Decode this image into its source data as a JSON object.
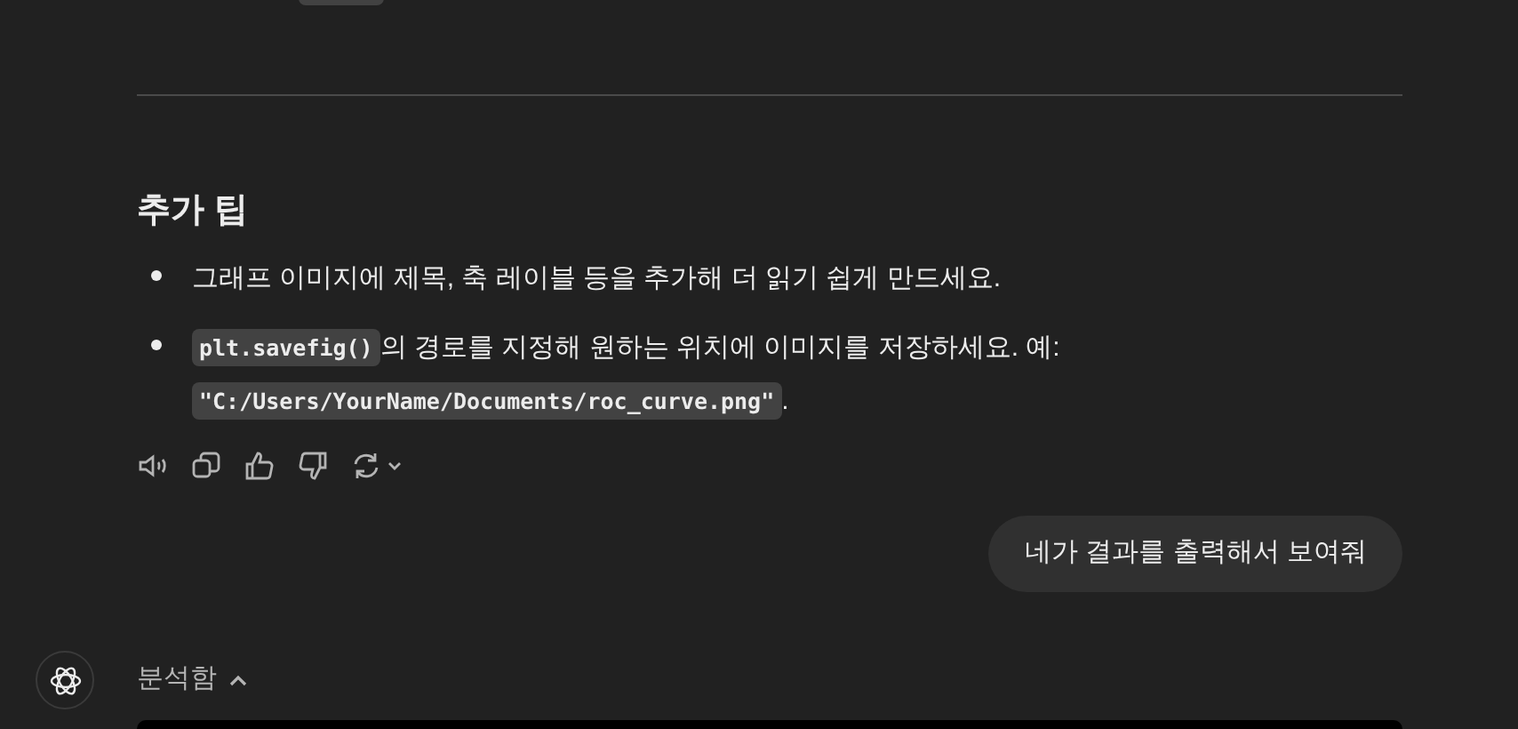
{
  "heading": "추가 팁",
  "bullets": [
    {
      "parts": [
        {
          "kind": "text",
          "text": "그래프 이미지에 제목, 축 레이블 등을 추가해 더 읽기 쉽게 만드세요."
        }
      ]
    },
    {
      "parts": [
        {
          "kind": "code",
          "text": "plt.savefig()"
        },
        {
          "kind": "text",
          "text": "의 경로를 지정해 원하는 위치에 이미지를 저장하세요. 예:"
        },
        {
          "kind": "code",
          "text": "\"C:/Users/YourName/Documents/roc_curve.png\""
        },
        {
          "kind": "text",
          "text": "."
        }
      ]
    }
  ],
  "user_message": "네가 결과를 출력해서 보여줘",
  "analysis": {
    "label": "분석함",
    "expanded": true
  }
}
